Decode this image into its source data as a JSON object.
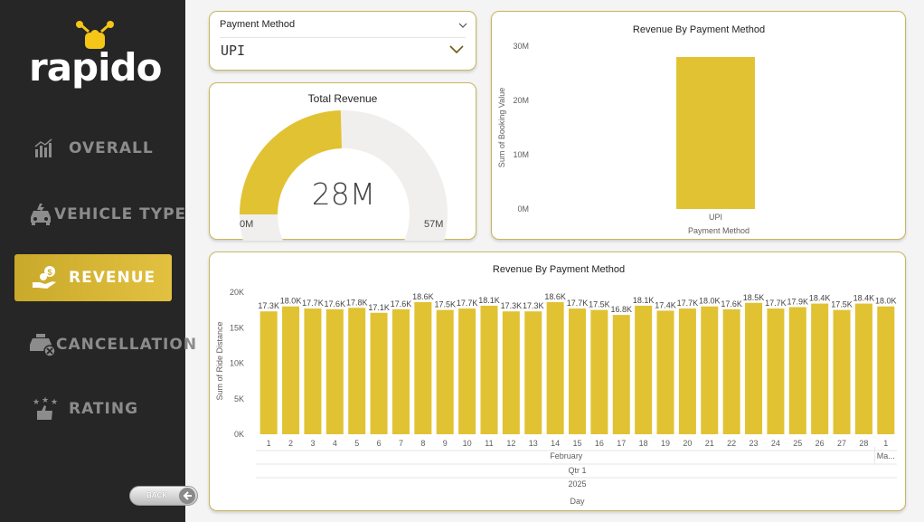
{
  "sidebar": {
    "logo_text": "rapido",
    "items": [
      {
        "label": "OVERALL",
        "icon": "bar-chart-icon",
        "active": false
      },
      {
        "label": "VEHICLE TYPE",
        "icon": "car-icon",
        "active": false
      },
      {
        "label": "REVENUE",
        "icon": "money-hand-icon",
        "active": true
      },
      {
        "label": "CANCELLATION",
        "icon": "cancelled-taxi-icon",
        "active": false
      },
      {
        "label": "RATING",
        "icon": "rating-thumbs-up-icon",
        "active": false
      }
    ],
    "back_label": "BACK"
  },
  "slicer": {
    "title": "Payment Method",
    "value": "UPI"
  },
  "gauge": {
    "title": "Total Revenue",
    "value_label": "28M",
    "min_label": "0M",
    "max_label": "57M",
    "value": 28,
    "min": 0,
    "max": 57,
    "fill_color": "#e1c233",
    "track_color": "#f0efee"
  },
  "colors": {
    "accent": "#e1c233",
    "sidebar_bg": "#262626",
    "card_border": "#c9b560"
  },
  "chart_data": [
    {
      "type": "bar",
      "title": "Revenue By Payment Method",
      "xlabel": "Payment Method",
      "ylabel": "Sum of Booking Value",
      "categories": [
        "UPI"
      ],
      "values": [
        28000000
      ],
      "ylim": [
        0,
        30000000
      ],
      "yticks": [
        0,
        10000000,
        20000000,
        30000000
      ],
      "ytick_labels": [
        "0M",
        "10M",
        "20M",
        "30M"
      ]
    },
    {
      "type": "bar",
      "title": "Revenue By Payment Method",
      "xlabel": "Day",
      "ylabel": "Sum of Ride Distance",
      "categories": [
        "1",
        "2",
        "3",
        "4",
        "5",
        "6",
        "7",
        "8",
        "9",
        "10",
        "11",
        "12",
        "13",
        "14",
        "15",
        "16",
        "17",
        "18",
        "19",
        "20",
        "21",
        "22",
        "23",
        "24",
        "25",
        "26",
        "27",
        "28",
        "1"
      ],
      "values": [
        17300,
        18000,
        17700,
        17600,
        17800,
        17100,
        17600,
        18600,
        17500,
        17700,
        18100,
        17300,
        17300,
        18600,
        17700,
        17500,
        16800,
        18100,
        17400,
        17700,
        18000,
        17600,
        18500,
        17700,
        17900,
        18400,
        17500,
        18400,
        18000
      ],
      "data_labels": [
        "17.3K",
        "18.0K",
        "17.7K",
        "17.6K",
        "17.8K",
        "17.1K",
        "17.6K",
        "18.6K",
        "17.5K",
        "17.7K",
        "18.1K",
        "17.3K",
        "17.3K",
        "18.6K",
        "17.7K",
        "17.5K",
        "16.8K",
        "18.1K",
        "17.4K",
        "17.7K",
        "18.0K",
        "17.6K",
        "18.5K",
        "17.7K",
        "17.9K",
        "18.4K",
        "17.5K",
        "18.4K",
        "18.0K"
      ],
      "ylim": [
        0,
        20000
      ],
      "yticks": [
        0,
        5000,
        10000,
        15000,
        20000
      ],
      "ytick_labels": [
        "0K",
        "5K",
        "10K",
        "15K",
        "20K"
      ],
      "hierarchy": {
        "month": "February",
        "month2": "Ma...",
        "quarter": "Qtr 1",
        "year": "2025"
      }
    }
  ]
}
